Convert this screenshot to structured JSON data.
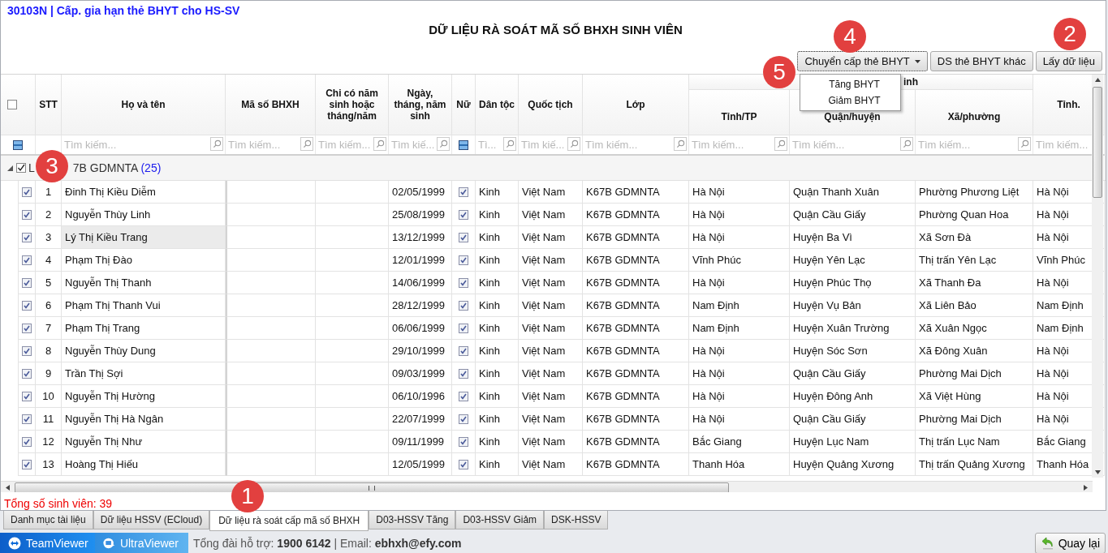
{
  "window": {
    "title": "30103N | Cấp. gia hạn thẻ BHYT cho HS-SV"
  },
  "heading": "DỮ LIỆU RÀ SOÁT MÃ SỐ BHXH SINH VIÊN",
  "toolbar": {
    "dropdown_button": "Chuyển cấp thẻ BHYT",
    "buttons": [
      "DS thẻ BHYT khác",
      "Lấy dữ liệu"
    ]
  },
  "dropdown_menu": [
    "Tăng BHYT",
    "Giảm BHYT"
  ],
  "callouts": [
    "1",
    "2",
    "3",
    "4",
    "5"
  ],
  "table": {
    "select_all": false,
    "column_group": "inh",
    "columns": [
      {
        "header": "STT",
        "in_group": false,
        "kind": "none"
      },
      {
        "header": "Họ và tên",
        "in_group": false,
        "kind": "text",
        "placeholder": "Tìm kiếm..."
      },
      {
        "header": "Mã số BHXH",
        "in_group": false,
        "kind": "text",
        "placeholder": "Tìm kiếm..."
      },
      {
        "header": "Chi có năm sinh hoặc tháng/năm",
        "in_group": false,
        "kind": "text",
        "placeholder": "Tìm kiếm..."
      },
      {
        "header": "Ngày, tháng, năm sinh",
        "in_group": false,
        "kind": "text",
        "placeholder": "Tìm kiế..."
      },
      {
        "header": "Nữ",
        "in_group": false,
        "kind": "toggle"
      },
      {
        "header": "Dân tộc",
        "in_group": false,
        "kind": "text",
        "placeholder": "Tì..."
      },
      {
        "header": "Quốc tịch",
        "in_group": false,
        "kind": "text",
        "placeholder": "Tìm kiế..."
      },
      {
        "header": "Lớp",
        "in_group": false,
        "kind": "text",
        "placeholder": "Tìm kiếm..."
      },
      {
        "header": "Tỉnh/TP",
        "in_group": true,
        "kind": "text",
        "placeholder": "Tìm kiếm..."
      },
      {
        "header": "Quận/huyện",
        "in_group": true,
        "kind": "text",
        "placeholder": "Tìm kiếm..."
      },
      {
        "header": "Xã/phường",
        "in_group": true,
        "kind": "text",
        "placeholder": "Tìm kiếm..."
      },
      {
        "header": "Tỉnh.",
        "in_group": false,
        "kind": "text",
        "placeholder": "Tìm kiếm..."
      }
    ],
    "group": {
      "expanded": true,
      "checked": true,
      "label_start": "L",
      "label": "7B GDMNTA",
      "count": "(25)"
    },
    "rows": [
      {
        "checked": true,
        "selected": false,
        "stt": "1",
        "name": "Đinh Thị Kiều Diễm",
        "dob": "02/05/1999",
        "female": true,
        "ethnicity": "Kinh",
        "nationality": "Việt Nam",
        "class": "K67B GDMNTA",
        "province": "Hà Nội",
        "district": "Quận Thanh Xuân",
        "ward": "Phường Phương Liệt",
        "province_2": "Hà Nội"
      },
      {
        "checked": true,
        "selected": false,
        "stt": "2",
        "name": "Nguyễn Thùy Linh",
        "dob": "25/08/1999",
        "female": true,
        "ethnicity": "Kinh",
        "nationality": "Việt Nam",
        "class": "K67B GDMNTA",
        "province": "Hà Nội",
        "district": "Quận Cầu Giấy",
        "ward": "Phường Quan Hoa",
        "province_2": "Hà Nội"
      },
      {
        "checked": true,
        "selected": true,
        "stt": "3",
        "name": "Lý Thị Kiều Trang",
        "dob": "13/12/1999",
        "female": true,
        "ethnicity": "Kinh",
        "nationality": "Việt Nam",
        "class": "K67B GDMNTA",
        "province": "Hà Nội",
        "district": "Huyện Ba Vì",
        "ward": "Xã Sơn Đà",
        "province_2": "Hà Nội"
      },
      {
        "checked": true,
        "selected": false,
        "stt": "4",
        "name": "Phạm Thị Đào",
        "dob": "12/01/1999",
        "female": true,
        "ethnicity": "Kinh",
        "nationality": "Việt Nam",
        "class": "K67B GDMNTA",
        "province": "Vĩnh Phúc",
        "district": "Huyện Yên Lạc",
        "ward": "Thị trấn Yên Lạc",
        "province_2": "Vĩnh Phúc"
      },
      {
        "checked": true,
        "selected": false,
        "stt": "5",
        "name": "Nguyễn Thị Thanh",
        "dob": "14/06/1999",
        "female": true,
        "ethnicity": "Kinh",
        "nationality": "Việt Nam",
        "class": "K67B GDMNTA",
        "province": "Hà Nội",
        "district": "Huyện Phúc Thọ",
        "ward": "Xã Thanh Đa",
        "province_2": "Hà Nội"
      },
      {
        "checked": true,
        "selected": false,
        "stt": "6",
        "name": "Phạm Thị Thanh Vui",
        "dob": "28/12/1999",
        "female": true,
        "ethnicity": "Kinh",
        "nationality": "Việt Nam",
        "class": "K67B GDMNTA",
        "province": "Nam Định",
        "district": "Huyện Vụ Bản",
        "ward": "Xã Liên Bảo",
        "province_2": "Nam Định"
      },
      {
        "checked": true,
        "selected": false,
        "stt": "7",
        "name": "Phạm Thị Trang",
        "dob": "06/06/1999",
        "female": true,
        "ethnicity": "Kinh",
        "nationality": "Việt Nam",
        "class": "K67B GDMNTA",
        "province": "Nam Định",
        "district": "Huyện Xuân Trường",
        "ward": "Xã Xuân Ngọc",
        "province_2": "Nam Định"
      },
      {
        "checked": true,
        "selected": false,
        "stt": "8",
        "name": "Nguyễn Thùy Dung",
        "dob": "29/10/1999",
        "female": true,
        "ethnicity": "Kinh",
        "nationality": "Việt Nam",
        "class": "K67B GDMNTA",
        "province": "Hà Nội",
        "district": "Huyện Sóc Sơn",
        "ward": "Xã Đông Xuân",
        "province_2": "Hà Nội"
      },
      {
        "checked": true,
        "selected": false,
        "stt": "9",
        "name": "Trần Thị Sợi",
        "dob": "09/03/1999",
        "female": true,
        "ethnicity": "Kinh",
        "nationality": "Việt Nam",
        "class": "K67B GDMNTA",
        "province": "Hà Nội",
        "district": "Quận Cầu Giấy",
        "ward": "Phường Mai Dịch",
        "province_2": "Hà Nội"
      },
      {
        "checked": true,
        "selected": false,
        "stt": "10",
        "name": "Nguyễn Thị Hường",
        "dob": "06/10/1996",
        "female": true,
        "ethnicity": "Kinh",
        "nationality": "Việt Nam",
        "class": "K67B GDMNTA",
        "province": "Hà Nội",
        "district": "Huyện Đông Anh",
        "ward": "Xã Việt Hùng",
        "province_2": "Hà Nội"
      },
      {
        "checked": true,
        "selected": false,
        "stt": "11",
        "name": "Nguyễn Thị Hà Ngân",
        "dob": "22/07/1999",
        "female": true,
        "ethnicity": "Kinh",
        "nationality": "Việt Nam",
        "class": "K67B GDMNTA",
        "province": "Hà Nội",
        "district": "Quận Cầu Giấy",
        "ward": "Phường Mai Dịch",
        "province_2": "Hà Nội"
      },
      {
        "checked": true,
        "selected": false,
        "stt": "12",
        "name": "Nguyễn Thị Như",
        "dob": "09/11/1999",
        "female": true,
        "ethnicity": "Kinh",
        "nationality": "Việt Nam",
        "class": "K67B GDMNTA",
        "province": "Bắc Giang",
        "district": "Huyện Lục Nam",
        "ward": "Thị trấn Lục Nam",
        "province_2": "Bắc Giang"
      },
      {
        "checked": true,
        "selected": false,
        "stt": "13",
        "name": "Hoàng Thị Hiếu",
        "dob": "12/05/1999",
        "female": true,
        "ethnicity": "Kinh",
        "nationality": "Việt Nam",
        "class": "K67B GDMNTA",
        "province": "Thanh Hóa",
        "district": "Huyện Quảng Xương",
        "ward": "Thị trấn Quảng Xương",
        "province_2": "Thanh Hóa"
      }
    ]
  },
  "total": "Tổng số sinh viên: 39",
  "tabs": [
    {
      "label": "Danh mục tài liệu",
      "selected": false
    },
    {
      "label": "Dữ liệu HSSV (ECloud)",
      "selected": false
    },
    {
      "label": "Dữ liệu rà soát cấp mã số BHXH",
      "selected": true
    },
    {
      "label": "D03-HSSV Tăng",
      "selected": false
    },
    {
      "label": "D03-HSSV Giảm",
      "selected": false
    },
    {
      "label": "DSK-HSSV",
      "selected": false
    }
  ],
  "footer": {
    "apps": [
      "TeamViewer",
      "UltraViewer"
    ],
    "support": "Tổng đài hỗ trợ: **1900 6142** | Email: **ebhxh@efy.com**",
    "back_button": "Quay lại"
  }
}
